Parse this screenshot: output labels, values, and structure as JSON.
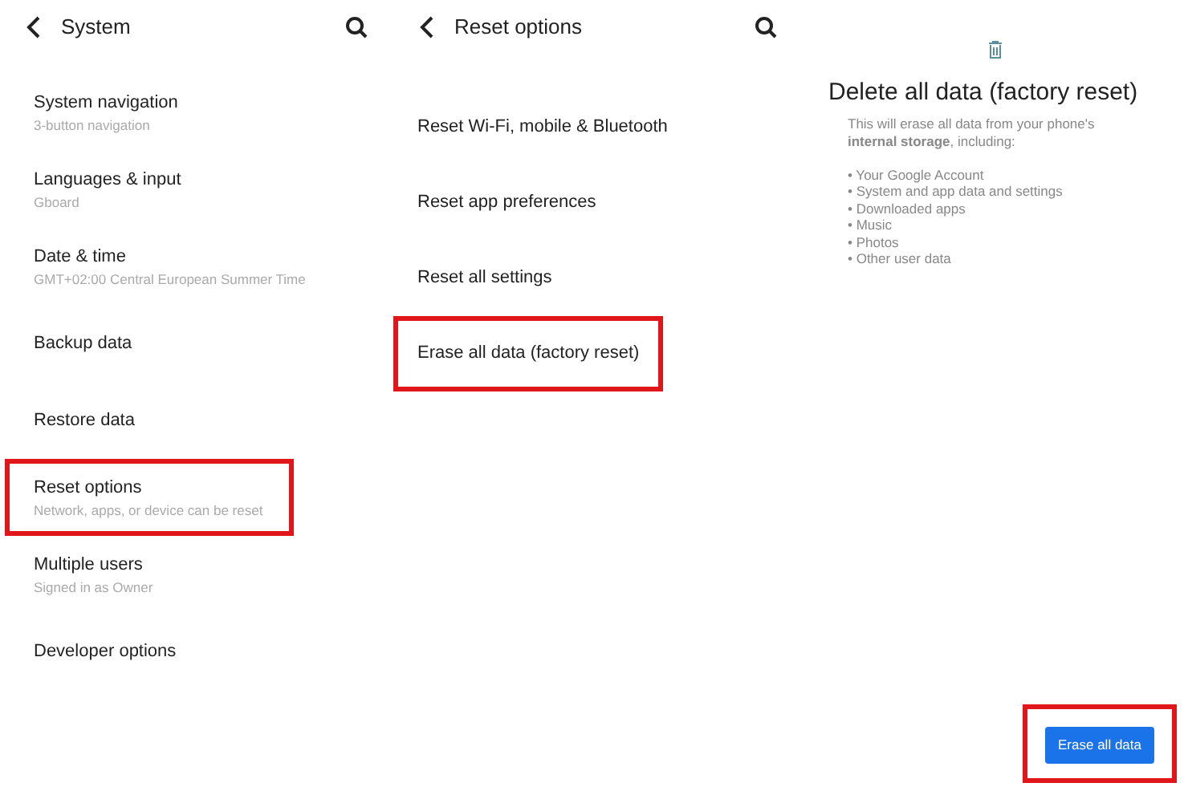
{
  "panels": [
    {
      "kind": "list",
      "header": {
        "title": "System"
      },
      "items": [
        {
          "title": "System navigation",
          "subtitle": "3-button navigation",
          "highlighted": false
        },
        {
          "title": "Languages & input",
          "subtitle": "Gboard",
          "highlighted": false
        },
        {
          "title": "Date & time",
          "subtitle": "GMT+02:00 Central European Summer Time",
          "highlighted": false
        },
        {
          "title": "Backup data",
          "highlighted": false
        },
        {
          "title": "Restore data",
          "highlighted": false
        },
        {
          "title": "Reset options",
          "subtitle": "Network, apps, or device can be reset",
          "highlighted": true
        },
        {
          "title": "Multiple users",
          "subtitle": "Signed in as Owner",
          "highlighted": false
        },
        {
          "title": "Developer options",
          "highlighted": false
        }
      ]
    },
    {
      "kind": "list",
      "header": {
        "title": "Reset options"
      },
      "items": [
        {
          "title": "Reset Wi-Fi, mobile & Bluetooth",
          "highlighted": false
        },
        {
          "title": "Reset app preferences",
          "highlighted": false
        },
        {
          "title": "Reset all settings",
          "highlighted": false
        },
        {
          "title": "Erase all data (factory reset)",
          "highlighted": true
        }
      ]
    },
    {
      "kind": "confirm",
      "title": "Delete all data (factory reset)",
      "description": "This will erase all data from your phone's **internal storage**, including:",
      "bullets": [
        "• Your Google Account",
        "• System and app data and settings",
        "• Downloaded apps",
        "• Music",
        "• Photos",
        "• Other user data"
      ],
      "button": {
        "label": "Erase all data",
        "highlighted": true
      }
    }
  ]
}
